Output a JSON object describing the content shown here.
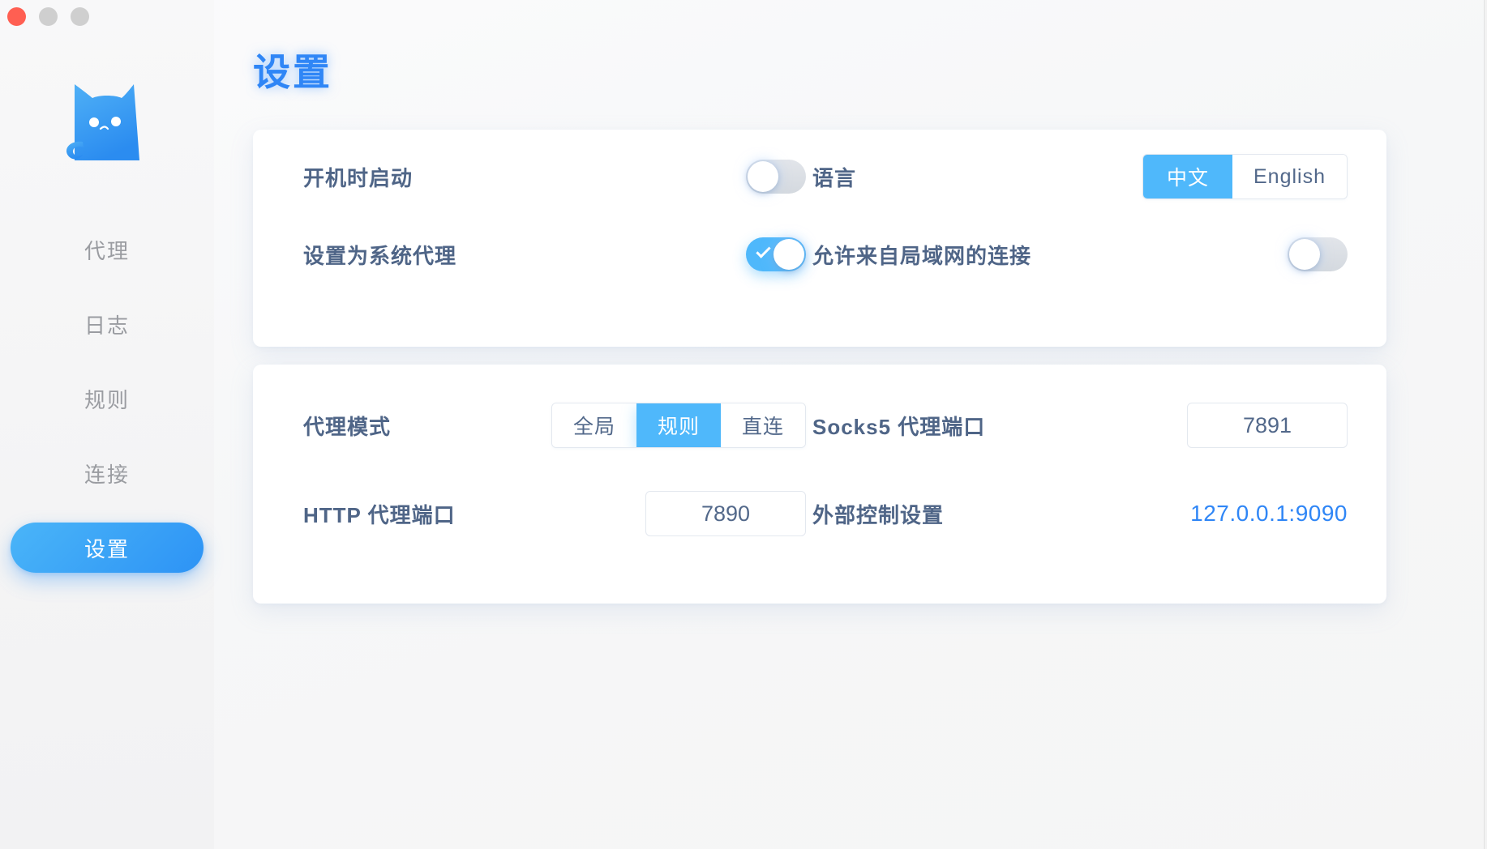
{
  "window": {
    "controls": [
      {
        "name": "close",
        "color": "#ff5f52"
      },
      {
        "name": "minimize",
        "color": "#cfcfcf"
      },
      {
        "name": "zoom",
        "color": "#cfcfcf"
      }
    ]
  },
  "sidebar": {
    "logo_name": "clash-cat-logo",
    "items": [
      {
        "label": "代理",
        "active": false
      },
      {
        "label": "日志",
        "active": false
      },
      {
        "label": "规则",
        "active": false
      },
      {
        "label": "连接",
        "active": false
      },
      {
        "label": "设置",
        "active": true
      }
    ]
  },
  "main": {
    "title": "设置",
    "general_card": {
      "startup": {
        "label": "开机时启动",
        "toggle_state": "off"
      },
      "system_proxy": {
        "label": "设置为系统代理",
        "toggle_state": "on"
      },
      "language": {
        "label": "语言",
        "options": [
          "中文",
          "English"
        ],
        "selected": "中文"
      },
      "allow_lan": {
        "label": "允许来自局域网的连接",
        "toggle_state": "off"
      }
    },
    "proxy_card": {
      "proxy_mode": {
        "label": "代理模式",
        "options": [
          "全局",
          "规则",
          "直连"
        ],
        "selected": "规则"
      },
      "socks5_port": {
        "label": "Socks5 代理端口",
        "value": "7891",
        "placeholder": "7891"
      },
      "http_port": {
        "label": "HTTP 代理端口",
        "value": "7890",
        "placeholder": "7890"
      },
      "external_control": {
        "label": "外部控制设置",
        "value": "127.0.0.1:9090"
      }
    }
  },
  "colors": {
    "accent": "#4fb8fb",
    "title_blue": "#2f86f6",
    "label_text": "#4f6587",
    "muted_text": "#9a9ca1",
    "card_bg": "#ffffff",
    "page_bg": "#f7f7f7"
  }
}
